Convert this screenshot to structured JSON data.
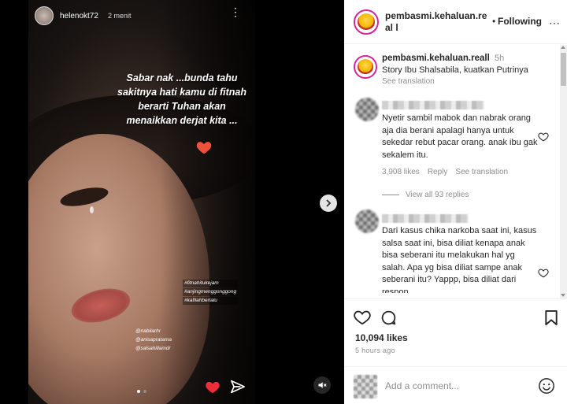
{
  "story": {
    "username": "helenokt72",
    "time": "2 menit",
    "caption": "Sabar nak ...bunda tahu sakitnya hati kamu di fitnah berarti Tuhan akan menaikkan derjat kita ...",
    "tags": [
      "#fitnahitukejam",
      "#anjingmenggonggong",
      "#kafilahberlalu"
    ],
    "mentions": [
      "@nabilarhr",
      "@anisapratama",
      "@salsahillamdr"
    ],
    "icons": {
      "heart": "red-heart-emoji",
      "like": "heart-icon",
      "send": "send-icon",
      "mute": "mute-icon",
      "next": "chevron-right-icon",
      "more": "more-vertical-icon"
    }
  },
  "post": {
    "username": "pembasmi.kehaluan.real l",
    "follow_status": "Following",
    "caption_username": "pembasmi.kehaluan.reall",
    "caption_time": "5h",
    "caption_text": "Story Ibu Shalsabila, kuatkan Putrinya",
    "see_translation": "See translation",
    "comments": [
      {
        "text": "Nyetir sambil mabok dan nabrak orang aja dia berani apalagi hanya untuk sekedar rebut pacar orang. anak ibu gak sekalem itu.",
        "likes": "3,908 likes",
        "reply": "Reply",
        "see_translation": "See translation",
        "view_replies": "View all 93 replies"
      },
      {
        "text": "Dari kasus chika narkoba saat ini, kasus salsa saat ini, bisa diliat kenapa anak bisa seberani itu melakukan hal yg salah. Apa yg bisa diliat sampe anak seberani itu? Yappp, bisa diliat dari respon"
      }
    ],
    "like_count": "10,094 likes",
    "time_ago": "5 hours ago",
    "add_comment_placeholder": "Add a comment...",
    "colors": {
      "accent": "#262626",
      "muted": "#8e8e8e",
      "heart": "#ed4956",
      "brand_ring": "#d6249f"
    }
  }
}
